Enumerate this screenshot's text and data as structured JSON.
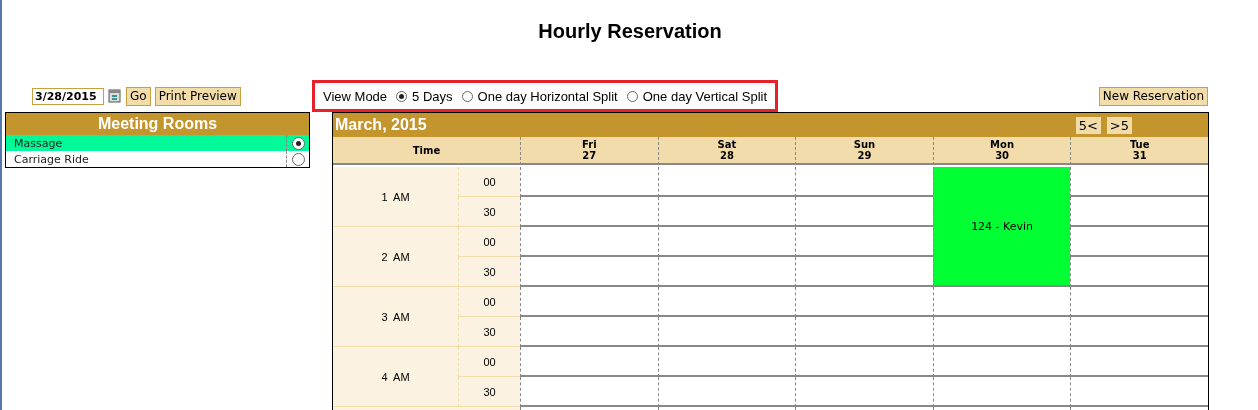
{
  "title": "Hourly Reservation",
  "toolbar": {
    "date": "3/28/2015",
    "go": "Go",
    "print_preview": "Print Preview",
    "new_reservation": "New Reservation"
  },
  "view_mode": {
    "label": "View Mode",
    "options": [
      {
        "label": "5 Days",
        "selected": true
      },
      {
        "label": "One day Horizontal Split",
        "selected": false
      },
      {
        "label": "One day Vertical Split",
        "selected": false
      }
    ]
  },
  "rooms": {
    "title": "Meeting Rooms",
    "items": [
      {
        "label": "Massage",
        "selected": true
      },
      {
        "label": "Carriage Ride",
        "selected": false
      }
    ]
  },
  "calendar": {
    "month": "March, 2015",
    "prev": "5<",
    "next": ">5",
    "time_header": "Time",
    "days": [
      {
        "name": "Fri",
        "date": "27",
        "slots": [
          {
            "booked": false
          },
          {
            "booked": false
          },
          {
            "booked": false
          },
          {
            "booked": false
          },
          {
            "booked": false
          },
          {
            "booked": false
          },
          {
            "booked": false
          },
          {
            "booked": false
          }
        ]
      },
      {
        "name": "Sat",
        "date": "28",
        "slots": [
          {
            "booked": false
          },
          {
            "booked": false
          },
          {
            "booked": false
          },
          {
            "booked": false
          },
          {
            "booked": false
          },
          {
            "booked": false
          },
          {
            "booked": false
          },
          {
            "booked": false
          }
        ]
      },
      {
        "name": "Sun",
        "date": "29",
        "slots": [
          {
            "booked": false
          },
          {
            "booked": false
          },
          {
            "booked": false
          },
          {
            "booked": false
          },
          {
            "booked": false
          },
          {
            "booked": false
          },
          {
            "booked": false
          },
          {
            "booked": false
          }
        ]
      },
      {
        "name": "Mon",
        "date": "30",
        "slots": [
          {
            "booked": true
          },
          {
            "booked": true
          },
          {
            "booked": true
          },
          {
            "booked": true
          },
          {
            "booked": false
          },
          {
            "booked": false
          },
          {
            "booked": false
          },
          {
            "booked": false
          }
        ],
        "reservation": {
          "label": "124 - Kevin",
          "color": "#00ff33"
        }
      },
      {
        "name": "Tue",
        "date": "31",
        "slots": [
          {
            "booked": false
          },
          {
            "booked": false
          },
          {
            "booked": false
          },
          {
            "booked": false
          },
          {
            "booked": false
          },
          {
            "booked": false
          },
          {
            "booked": false
          },
          {
            "booked": false
          }
        ]
      }
    ],
    "hours": [
      {
        "label": "1  AM",
        "minutes": [
          "00",
          "30"
        ]
      },
      {
        "label": "2  AM",
        "minutes": [
          "00",
          "30"
        ]
      },
      {
        "label": "3  AM",
        "minutes": [
          "00",
          "30"
        ]
      },
      {
        "label": "4  AM",
        "minutes": [
          "00",
          "30"
        ]
      }
    ]
  }
}
